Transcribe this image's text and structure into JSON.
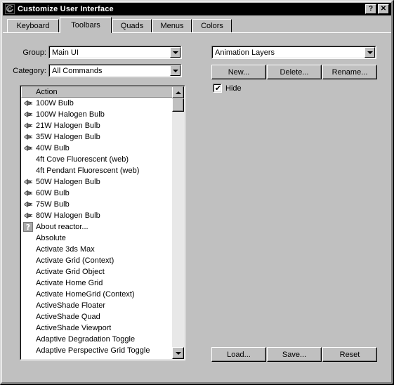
{
  "window": {
    "title": "Customize User Interface",
    "icon": "max-swirl-icon",
    "buttons": [
      {
        "name": "help-button",
        "label": "?"
      },
      {
        "name": "close-button",
        "label": "✕"
      }
    ]
  },
  "tabs": [
    {
      "label": "Keyboard",
      "active": false
    },
    {
      "label": "Toolbars",
      "active": true
    },
    {
      "label": "Quads",
      "active": false
    },
    {
      "label": "Menus",
      "active": false
    },
    {
      "label": "Colors",
      "active": false
    }
  ],
  "left_panel": {
    "group": {
      "label": "Group:",
      "value": "Main UI"
    },
    "category": {
      "label": "Category:",
      "value": "All Commands"
    },
    "list": {
      "column_header": "Action",
      "items": [
        {
          "label": "100W Bulb",
          "icon": "bulb-icon"
        },
        {
          "label": "100W Halogen Bulb",
          "icon": "bulb-icon"
        },
        {
          "label": "21W Halogen Bulb",
          "icon": "bulb-icon"
        },
        {
          "label": "35W Halogen Bulb",
          "icon": "bulb-icon"
        },
        {
          "label": "40W Bulb",
          "icon": "bulb-icon"
        },
        {
          "label": "4ft Cove Fluorescent (web)",
          "icon": "none"
        },
        {
          "label": "4ft Pendant Fluorescent (web)",
          "icon": "none"
        },
        {
          "label": "50W Halogen Bulb",
          "icon": "bulb-icon"
        },
        {
          "label": "60W Bulb",
          "icon": "bulb-icon"
        },
        {
          "label": "75W Bulb",
          "icon": "bulb-icon"
        },
        {
          "label": "80W Halogen Bulb",
          "icon": "bulb-icon"
        },
        {
          "label": "About reactor...",
          "icon": "question-icon"
        },
        {
          "label": "Absolute",
          "icon": "none"
        },
        {
          "label": "Activate 3ds Max",
          "icon": "none"
        },
        {
          "label": "Activate Grid (Context)",
          "icon": "none"
        },
        {
          "label": "Activate Grid Object",
          "icon": "none"
        },
        {
          "label": "Activate Home Grid",
          "icon": "none"
        },
        {
          "label": "Activate HomeGrid (Context)",
          "icon": "none"
        },
        {
          "label": "ActiveShade Floater",
          "icon": "none"
        },
        {
          "label": "ActiveShade Quad",
          "icon": "none"
        },
        {
          "label": "ActiveShade Viewport",
          "icon": "none"
        },
        {
          "label": "Adaptive Degradation Toggle",
          "icon": "none"
        },
        {
          "label": "Adaptive Perspective Grid Toggle",
          "icon": "none"
        }
      ]
    }
  },
  "right_panel": {
    "toolbar_select": {
      "value": "Animation Layers"
    },
    "buttons": [
      {
        "name": "new-button",
        "label": "New..."
      },
      {
        "name": "delete-button",
        "label": "Delete..."
      },
      {
        "name": "rename-button",
        "label": "Rename..."
      }
    ],
    "hide_checkbox": {
      "label": "Hide",
      "checked": true,
      "mark": "✔"
    }
  },
  "footer": {
    "buttons": [
      {
        "name": "load-button",
        "label": "Load..."
      },
      {
        "name": "save-button",
        "label": "Save..."
      },
      {
        "name": "reset-button",
        "label": "Reset"
      }
    ]
  },
  "colors": {
    "face": "#c0c0c0",
    "titlebar": "#000000",
    "titlebar_text": "#ffffff",
    "field": "#ffffff",
    "shadow": "#808080"
  }
}
